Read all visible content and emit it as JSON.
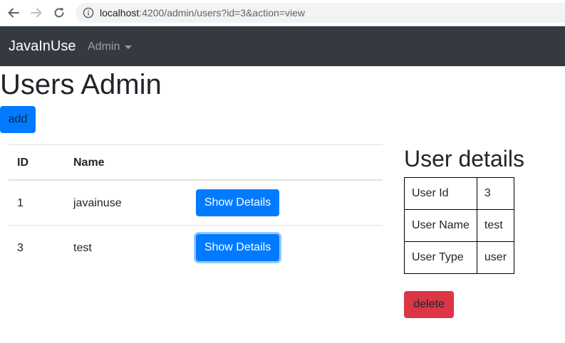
{
  "browser": {
    "url_host": "localhost",
    "url_rest": ":4200/admin/users?id=3&action=view"
  },
  "navbar": {
    "brand": "JavaInUse",
    "menu_label": "Admin"
  },
  "page": {
    "title": "Users Admin",
    "add_label": "add"
  },
  "users_table": {
    "headers": [
      "ID",
      "Name"
    ],
    "rows": [
      {
        "id": "1",
        "name": "javainuse",
        "action": "Show Details"
      },
      {
        "id": "3",
        "name": "test",
        "action": "Show Details"
      }
    ]
  },
  "details": {
    "title": "User details",
    "rows": [
      {
        "label": "User Id",
        "value": "3"
      },
      {
        "label": "User Name",
        "value": "test"
      },
      {
        "label": "User Type",
        "value": "user"
      }
    ],
    "delete_label": "delete"
  },
  "colors": {
    "navbar_bg": "#343a40",
    "primary": "#007bff",
    "danger": "#dc3545"
  }
}
